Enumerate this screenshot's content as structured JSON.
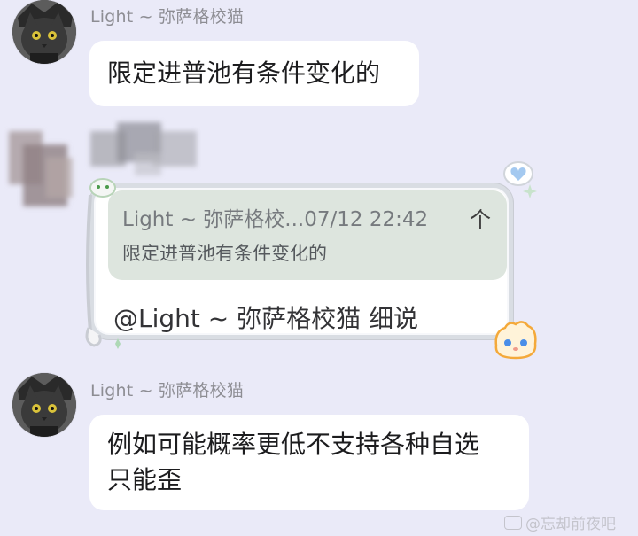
{
  "messages": [
    {
      "sender": "Light ~ 弥萨格校猫",
      "text": "限定进普池有条件变化的"
    },
    {
      "sender": "",
      "quote": {
        "meta": "Light ~ 弥萨格校...07/12 22:42",
        "text": "限定进普池有条件变化的"
      },
      "text": "@Light ~ 弥萨格校猫 细说"
    },
    {
      "sender": "Light ~ 弥萨格校猫",
      "text_lines": [
        "例如可能概率更低不支持各种自选",
        "只能歪"
      ]
    }
  ],
  "quote_arrow": "个",
  "watermark": {
    "text": "@忘却前夜吧",
    "icon": "tieba-icon"
  },
  "colors": {
    "background": "#eaeaf8",
    "bubble": "#ffffff",
    "quote_box": "#dde5de",
    "name": "#8d8d93",
    "frame": "#d9dde3"
  },
  "icons": [
    "cat-avatar",
    "heart-icon",
    "sparkle-icon",
    "cat-paw-decoration",
    "flame-mascot-icon",
    "pixel-cat-sticker"
  ]
}
